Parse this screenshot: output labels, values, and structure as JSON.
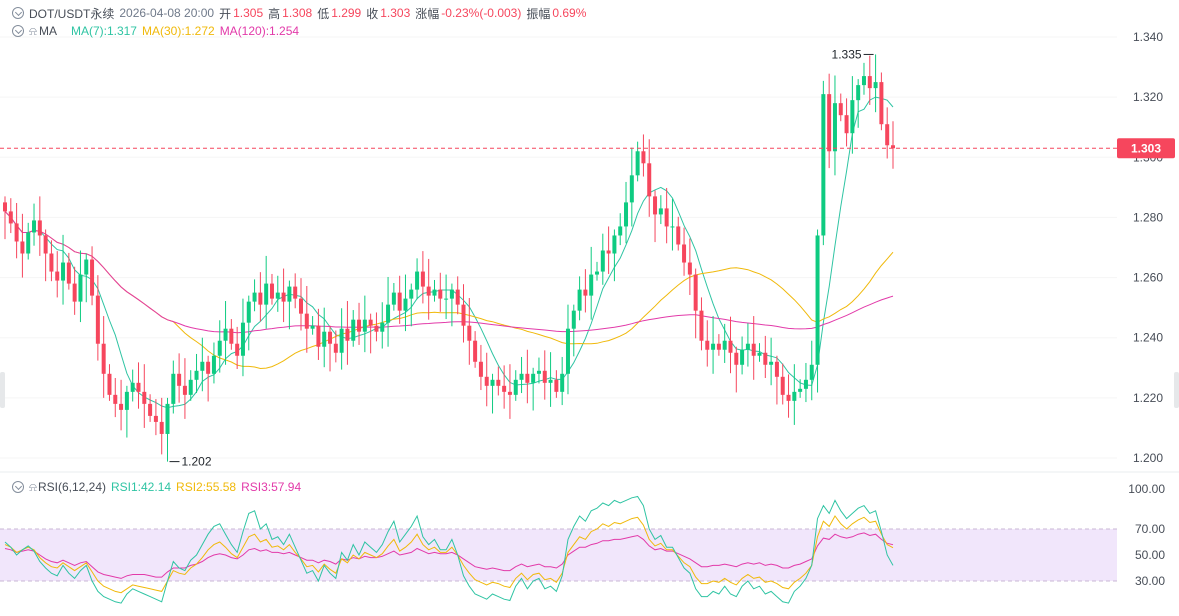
{
  "header": {
    "symbol": "DOT/USDT永续",
    "datetime": "2026-04-08 20:00",
    "open_label": "开",
    "open_value": "1.305",
    "high_label": "高",
    "high_value": "1.308",
    "low_label": "低",
    "low_value": "1.299",
    "close_label": "收",
    "close_value": "1.303",
    "change_label": "涨幅",
    "change_value": "-0.23%(-0.003)",
    "amplitude_label": "振幅",
    "amplitude_value": "0.69%"
  },
  "ma_row": {
    "label": "MA",
    "ma7": "MA(7):1.317",
    "ma30": "MA(30):1.272",
    "ma120": "MA(120):1.254"
  },
  "rsi_row": {
    "label": "RSI(6,12,24)",
    "rsi1": "RSI1:42.14",
    "rsi2": "RSI2:55.58",
    "rsi3": "RSI3:57.94"
  },
  "price_axis": [
    "1.340",
    "1.320",
    "1.300",
    "1.280",
    "1.260",
    "1.240",
    "1.220",
    "1.200"
  ],
  "current_price": "1.303",
  "rsi_axis": [
    "100.00",
    "70.00",
    "50.00",
    "30.00"
  ],
  "max_annotation": "1.335",
  "min_annotation": "1.202",
  "colors": {
    "up": "#0ecb81",
    "down": "#f6465d",
    "ma7": "#2fc4a3",
    "ma30": "#f0b90b",
    "ma120": "#e23aa9",
    "rsi_band": "#f1e6fb"
  },
  "chart_data": {
    "type": "candlestick",
    "price_range": [
      1.195,
      1.345
    ],
    "rsi_range": [
      25,
      100
    ],
    "close": [
      1.282,
      1.278,
      1.272,
      1.268,
      1.275,
      1.279,
      1.274,
      1.268,
      1.262,
      1.259,
      1.265,
      1.258,
      1.252,
      1.261,
      1.266,
      1.254,
      1.238,
      1.228,
      1.221,
      1.218,
      1.216,
      1.222,
      1.225,
      1.222,
      1.218,
      1.214,
      1.212,
      1.208,
      1.218,
      1.228,
      1.224,
      1.221,
      1.226,
      1.229,
      1.232,
      1.228,
      1.234,
      1.239,
      1.243,
      1.238,
      1.234,
      1.245,
      1.252,
      1.255,
      1.251,
      1.258,
      1.253,
      1.255,
      1.252,
      1.257,
      1.253,
      1.248,
      1.243,
      1.244,
      1.237,
      1.242,
      1.238,
      1.235,
      1.243,
      1.239,
      1.246,
      1.242,
      1.246,
      1.244,
      1.242,
      1.245,
      1.251,
      1.255,
      1.249,
      1.253,
      1.256,
      1.262,
      1.257,
      1.254,
      1.256,
      1.253,
      1.253,
      1.256,
      1.251,
      1.244,
      1.239,
      1.232,
      1.227,
      1.224,
      1.226,
      1.224,
      1.222,
      1.221,
      1.226,
      1.228,
      1.225,
      1.228,
      1.229,
      1.225,
      1.226,
      1.222,
      1.228,
      1.243,
      1.249,
      1.256,
      1.254,
      1.261,
      1.262,
      1.269,
      1.268,
      1.274,
      1.277,
      1.285,
      1.294,
      1.302,
      1.298,
      1.287,
      1.281,
      1.283,
      1.277,
      1.277,
      1.271,
      1.265,
      1.261,
      1.249,
      1.239,
      1.236,
      1.238,
      1.236,
      1.239,
      1.235,
      1.231,
      1.236,
      1.238,
      1.234,
      1.235,
      1.231,
      1.232,
      1.227,
      1.221,
      1.219,
      1.222,
      1.223,
      1.226,
      1.231,
      1.274,
      1.321,
      1.302,
      1.318,
      1.314,
      1.308,
      1.319,
      1.324,
      1.327,
      1.323,
      1.325,
      1.311,
      1.304,
      1.303
    ],
    "rsi1": [
      60,
      56,
      50,
      54,
      57,
      53,
      45,
      40,
      36,
      34,
      42,
      36,
      32,
      38,
      42,
      30,
      22,
      18,
      16,
      14,
      13,
      20,
      24,
      22,
      20,
      18,
      16,
      14,
      30,
      45,
      40,
      38,
      46,
      50,
      58,
      66,
      72,
      74,
      66,
      58,
      52,
      68,
      82,
      84,
      70,
      74,
      62,
      64,
      58,
      66,
      56,
      46,
      36,
      38,
      30,
      42,
      36,
      32,
      52,
      46,
      58,
      50,
      60,
      56,
      52,
      58,
      68,
      76,
      60,
      66,
      72,
      80,
      64,
      58,
      62,
      54,
      54,
      62,
      50,
      34,
      26,
      20,
      18,
      16,
      20,
      18,
      16,
      15,
      26,
      32,
      24,
      30,
      32,
      24,
      26,
      22,
      34,
      62,
      72,
      80,
      76,
      84,
      86,
      90,
      88,
      92,
      90,
      92,
      94,
      95,
      88,
      70,
      62,
      65,
      56,
      56,
      48,
      40,
      36,
      24,
      18,
      18,
      22,
      20,
      26,
      20,
      18,
      26,
      30,
      24,
      26,
      20,
      22,
      18,
      14,
      13,
      22,
      26,
      32,
      42,
      78,
      88,
      82,
      92,
      84,
      78,
      82,
      86,
      88,
      82,
      84,
      68,
      50,
      42
    ],
    "rsi2": [
      58,
      56,
      52,
      54,
      56,
      54,
      48,
      44,
      41,
      40,
      44,
      41,
      38,
      41,
      44,
      37,
      30,
      26,
      24,
      22,
      21,
      24,
      27,
      26,
      25,
      24,
      23,
      22,
      30,
      38,
      36,
      35,
      40,
      43,
      48,
      54,
      58,
      60,
      56,
      51,
      48,
      56,
      64,
      66,
      60,
      62,
      56,
      57,
      54,
      58,
      52,
      47,
      41,
      42,
      37,
      43,
      39,
      36,
      47,
      44,
      50,
      47,
      52,
      50,
      48,
      51,
      57,
      62,
      53,
      56,
      60,
      66,
      58,
      54,
      56,
      52,
      52,
      56,
      50,
      42,
      36,
      31,
      29,
      27,
      29,
      28,
      26,
      25,
      32,
      36,
      31,
      35,
      36,
      31,
      32,
      29,
      36,
      52,
      58,
      64,
      62,
      68,
      70,
      74,
      72,
      75,
      74,
      76,
      78,
      79,
      73,
      62,
      57,
      59,
      54,
      54,
      49,
      44,
      41,
      33,
      28,
      28,
      30,
      29,
      32,
      29,
      27,
      32,
      35,
      32,
      33,
      29,
      30,
      28,
      25,
      24,
      29,
      32,
      36,
      42,
      64,
      76,
      72,
      80,
      74,
      70,
      74,
      77,
      79,
      75,
      76,
      66,
      58,
      55.58
    ],
    "rsi3": [
      55,
      54,
      52,
      53,
      54,
      53,
      50,
      47,
      45,
      44,
      46,
      44,
      42,
      44,
      45,
      41,
      37,
      35,
      34,
      33,
      32,
      34,
      35,
      35,
      35,
      34,
      33,
      33,
      37,
      40,
      40,
      40,
      42,
      43,
      45,
      48,
      50,
      51,
      50,
      48,
      47,
      50,
      54,
      55,
      53,
      54,
      52,
      52,
      51,
      52,
      50,
      48,
      46,
      46,
      44,
      46,
      45,
      43,
      47,
      46,
      48,
      47,
      49,
      48,
      48,
      49,
      51,
      53,
      50,
      51,
      52,
      55,
      53,
      51,
      52,
      51,
      51,
      52,
      50,
      47,
      44,
      41,
      40,
      39,
      40,
      39,
      38,
      38,
      41,
      43,
      41,
      42,
      43,
      41,
      41,
      40,
      43,
      50,
      53,
      56,
      56,
      58,
      59,
      61,
      61,
      62,
      62,
      63,
      64,
      65,
      62,
      57,
      54,
      55,
      53,
      53,
      51,
      49,
      47,
      44,
      41,
      41,
      42,
      42,
      43,
      42,
      41,
      43,
      44,
      43,
      44,
      42,
      43,
      42,
      40,
      40,
      42,
      43,
      45,
      47,
      57,
      63,
      62,
      66,
      64,
      63,
      64,
      66,
      67,
      65,
      66,
      62,
      59,
      57.94
    ]
  }
}
